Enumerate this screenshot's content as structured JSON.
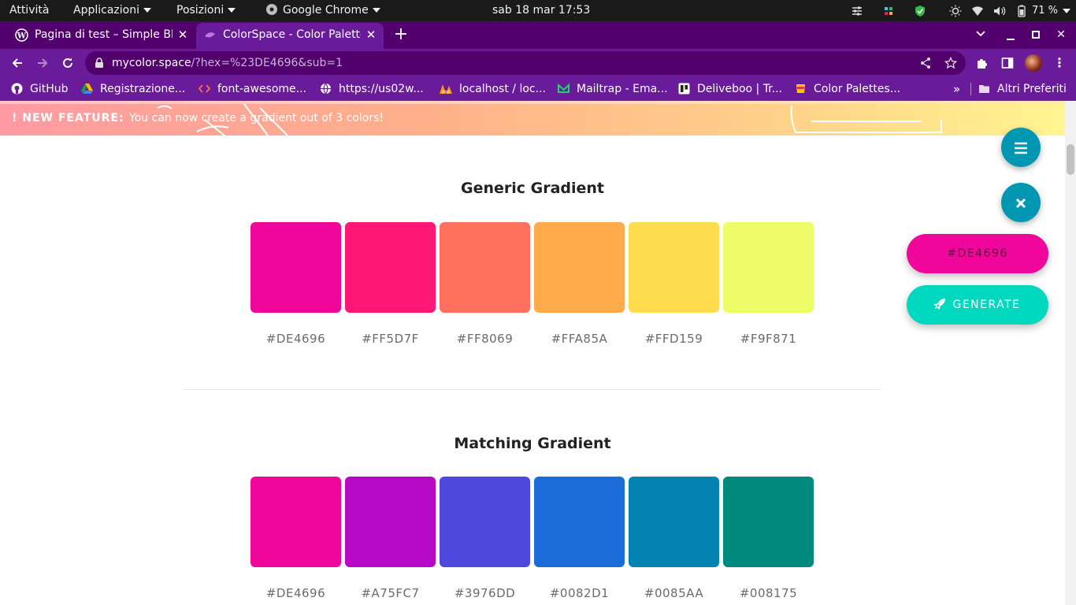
{
  "system_bar": {
    "activities": "Attività",
    "applications": "Applicazioni",
    "places": "Posizioni",
    "active_app": "Google Chrome",
    "datetime": "sab 18 mar  17:53",
    "battery": "71 %"
  },
  "tabs": [
    {
      "title": "Pagina di test – Simple Blo",
      "icon": "wordpress-icon",
      "active": false
    },
    {
      "title": "ColorSpace - Color Palette",
      "icon": "colorspace-icon",
      "active": true
    }
  ],
  "address_bar": {
    "host": "mycolor.space",
    "path": "/?hex=%23DE4696&sub=1"
  },
  "bookmarks": [
    {
      "label": "GitHub",
      "icon": "github-icon"
    },
    {
      "label": "Registrazione...",
      "icon": "google-drive-icon"
    },
    {
      "label": "font-awesome...",
      "icon": "code-icon"
    },
    {
      "label": "https://us02w...",
      "icon": "globe-icon"
    },
    {
      "label": "localhost / loc...",
      "icon": "phpmyadmin-icon"
    },
    {
      "label": "Mailtrap - Ema...",
      "icon": "mailtrap-icon"
    },
    {
      "label": "Deliveboo | Tr...",
      "icon": "trello-icon"
    },
    {
      "label": "Color Palettes...",
      "icon": "palette-icon"
    }
  ],
  "other_bookmarks": "Altri Preferiti",
  "banner": {
    "prefix": "! NEW FEATURE:",
    "text": "You can now create a gradient out of 3 colors!"
  },
  "sections": [
    {
      "title": "Generic Gradient",
      "swatches": [
        {
          "hex": "#DE4696",
          "color": "#f0069a"
        },
        {
          "hex": "#FF5D7F",
          "color": "#ff1776"
        },
        {
          "hex": "#FF8069",
          "color": "#ff705f"
        },
        {
          "hex": "#FFA85A",
          "color": "#ffab4c"
        },
        {
          "hex": "#FFD159",
          "color": "#ffdc4e"
        },
        {
          "hex": "#F9F871",
          "color": "#eefc68"
        }
      ]
    },
    {
      "title": "Matching Gradient",
      "swatches": [
        {
          "hex": "#DE4696",
          "color": "#f0069a"
        },
        {
          "hex": "#A75FC7",
          "color": "#b708c6"
        },
        {
          "hex": "#3976DD",
          "color": "#4f48df"
        },
        {
          "hex": "#0082D1",
          "color": "#1b6cd7"
        },
        {
          "hex": "#0085AA",
          "color": "#0283b1"
        },
        {
          "hex": "#008175",
          "color": "#008a7b"
        }
      ]
    }
  ],
  "sidebar": {
    "color_input": "#DE4696",
    "generate_label": "GENERATE",
    "accent": "#0097b2",
    "input_bg": "#f0069a",
    "generate_bg": "#00d8c0"
  }
}
